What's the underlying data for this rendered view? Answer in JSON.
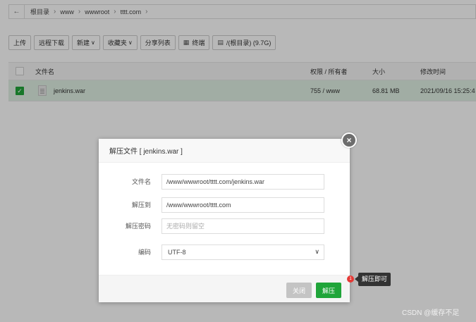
{
  "pathbar": {
    "back_icon": "arrow-left",
    "crumbs": [
      "根目录",
      "www",
      "wwwroot",
      "tttt.com"
    ]
  },
  "toolbar": {
    "upload": "上传",
    "remote_download": "远程下载",
    "new": "新建",
    "favorites": "收藏夹",
    "share_list": "分享列表",
    "terminal": "终端",
    "disk": "/(根目录) (9.7G)"
  },
  "table": {
    "headers": {
      "name": "文件名",
      "perm": "权限 / 所有者",
      "size": "大小",
      "mtime": "修改时间"
    },
    "rows": [
      {
        "name": "jenkins.war",
        "perm": "755 / www",
        "size": "68.81 MB",
        "mtime": "2021/09/16 15:25:4",
        "checked": true
      }
    ]
  },
  "dialog": {
    "title": "解压文件 [ jenkins.war ]",
    "fields": {
      "filename_label": "文件名",
      "filename_value": "/www/wwwroot/tttt.com/jenkins.war",
      "dest_label": "解压到",
      "dest_value": "/www/wwwroot/tttt.com",
      "password_label": "解压密码",
      "password_placeholder": "无密码则留空",
      "encoding_label": "编码",
      "encoding_value": "UTF-8"
    },
    "buttons": {
      "close": "关闭",
      "extract": "解压"
    }
  },
  "badge": "1",
  "tooltip": "解压即可",
  "watermark": "CSDN @缓存不足",
  "colors": {
    "primary": "#20a53a",
    "selected_row": "#dff0e3",
    "badge": "#e53935"
  }
}
